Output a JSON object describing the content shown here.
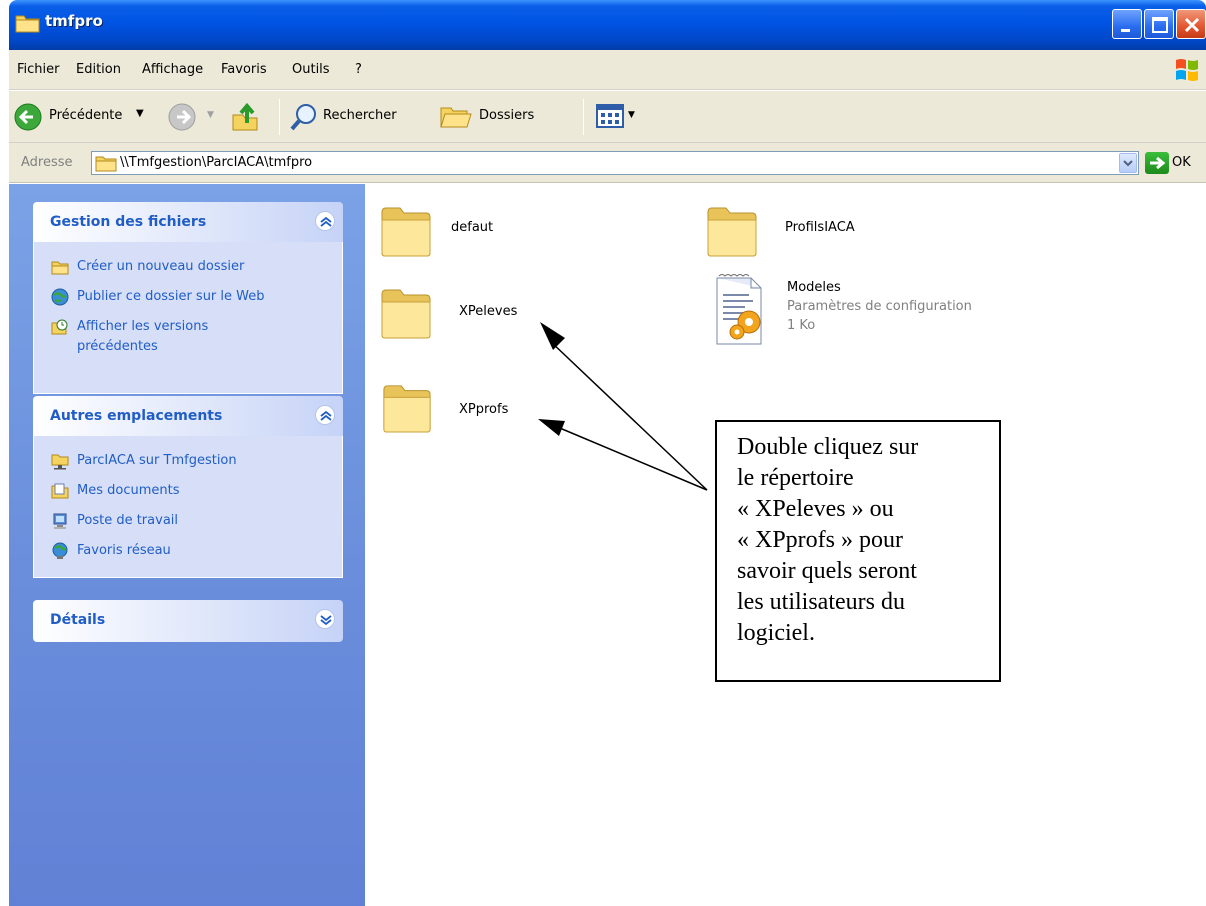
{
  "window": {
    "title": "tmfpro"
  },
  "menu": {
    "items": [
      "Fichier",
      "Edition",
      "Affichage",
      "Favoris",
      "Outils",
      "?"
    ]
  },
  "toolbar": {
    "back_label": "Précédente",
    "search_label": "Rechercher",
    "folders_label": "Dossiers"
  },
  "address": {
    "label": "Adresse",
    "value": "\\\\Tmfgestion\\ParcIACA\\tmfpro",
    "go_label": "OK"
  },
  "taskpane": {
    "file_tasks": {
      "title": "Gestion des fichiers",
      "items": [
        {
          "label": "Créer un nouveau dossier",
          "icon": "new-folder-icon"
        },
        {
          "label": "Publier ce dossier sur le Web",
          "icon": "web-publish-icon"
        },
        {
          "label": "Afficher les versions",
          "label2": "précédentes",
          "icon": "previous-versions-icon"
        }
      ]
    },
    "other_places": {
      "title": "Autres emplacements",
      "items": [
        {
          "label": "ParcIACA sur Tmfgestion",
          "icon": "network-folder-icon"
        },
        {
          "label": "Mes documents",
          "icon": "my-documents-icon"
        },
        {
          "label": "Poste de travail",
          "icon": "my-computer-icon"
        },
        {
          "label": "Favoris réseau",
          "icon": "network-places-icon"
        }
      ]
    },
    "details": {
      "title": "Détails"
    }
  },
  "files": [
    {
      "name": "defaut",
      "type": "folder"
    },
    {
      "name": "ProfilsIACA",
      "type": "folder"
    },
    {
      "name": "XPeleves",
      "type": "folder"
    },
    {
      "name": "Modeles",
      "type": "config-file",
      "desc": "Paramètres de configuration",
      "size": "1 Ko"
    },
    {
      "name": "XPprofs",
      "type": "folder"
    }
  ],
  "callout": {
    "lines": [
      "Double cliquez sur",
      "le répertoire",
      "« XPeleves » ou",
      "« XPprofs » pour",
      "savoir quels seront",
      "les utilisateurs du",
      "logiciel."
    ]
  },
  "colors": {
    "titlebar": "#0054e3",
    "taskpane": "#6b8fdc",
    "task_link": "#215dc6",
    "chrome": "#ece9d8"
  }
}
